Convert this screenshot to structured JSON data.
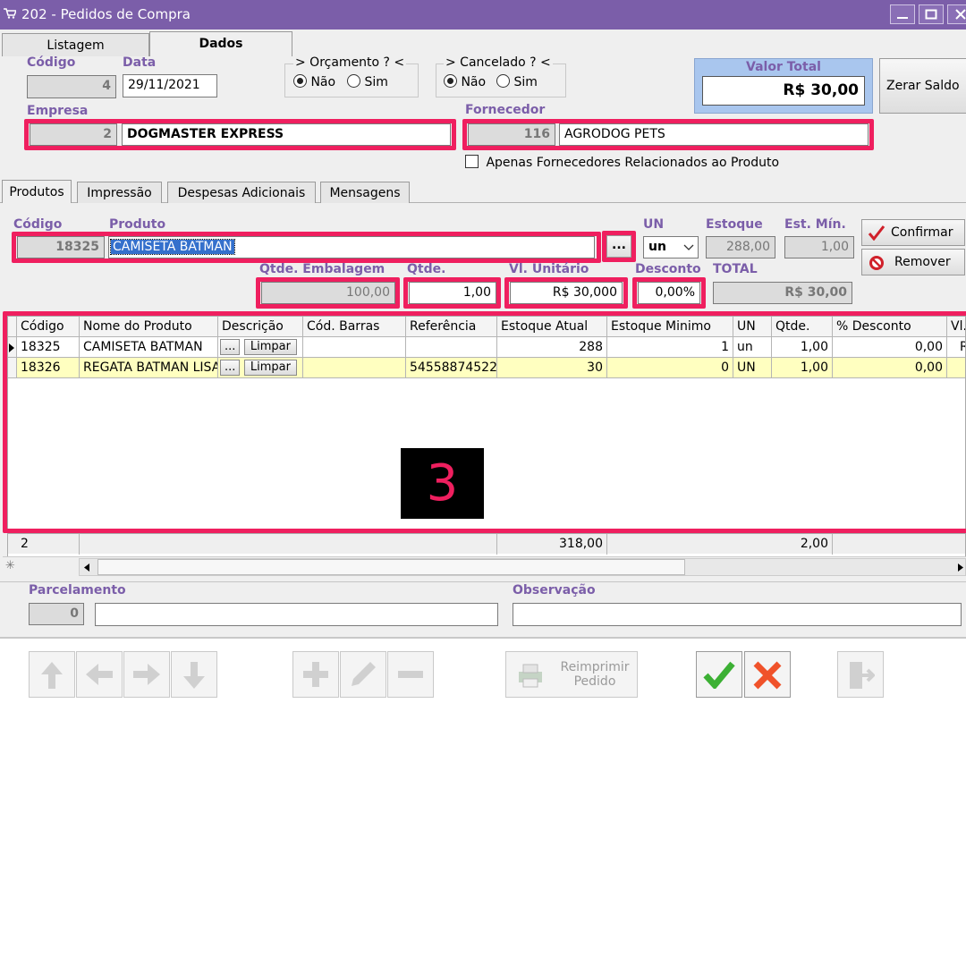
{
  "window": {
    "title": "202 - Pedidos de Compra"
  },
  "main_tabs": [
    {
      "label": "Listagem"
    },
    {
      "label": "Dados"
    }
  ],
  "header": {
    "codigo_label": "Código",
    "codigo_value": "4",
    "data_label": "Data",
    "data_value": "29/11/2021",
    "orcamento": {
      "legend": "> Orçamento ? <",
      "opt_nao": "Não",
      "opt_sim": "Sim",
      "selected": "Não"
    },
    "cancelado": {
      "legend": "> Cancelado ? <",
      "opt_nao": "Não",
      "opt_sim": "Sim",
      "selected": "Não"
    },
    "valor_total_label": "Valor Total",
    "valor_total_value": "R$ 30,00",
    "zerar_saldo": "Zerar Saldo",
    "empresa_label": "Empresa",
    "empresa_code": "2",
    "empresa_name": "DOGMASTER EXPRESS",
    "fornecedor_label": "Fornecedor",
    "fornecedor_code": "116",
    "fornecedor_name": "AGRODOG PETS",
    "apenas_checkbox": "Apenas Fornecedores Relacionados ao Produto"
  },
  "sub_tabs": [
    {
      "label": "Produtos"
    },
    {
      "label": "Impressão"
    },
    {
      "label": "Despesas Adicionais"
    },
    {
      "label": "Mensagens"
    }
  ],
  "product_form": {
    "codigo_label": "Código",
    "codigo_value": "18325",
    "produto_label": "Produto",
    "produto_value": "CAMISETA BATMAN",
    "lookup_button": "...",
    "un_label": "UN",
    "un_value": "un",
    "estoque_label": "Estoque",
    "estoque_value": "288,00",
    "est_min_label": "Est. Mín.",
    "est_min_value": "1,00",
    "confirmar": "Confirmar",
    "remover": "Remover",
    "qtde_emb_label": "Qtde. Embalagem",
    "qtde_emb_value": "100,00",
    "qtde_label": "Qtde.",
    "qtde_value": "1,00",
    "vl_unit_label": "Vl. Unitário",
    "vl_unit_value": "R$ 30,000",
    "desconto_label": "Desconto",
    "desconto_value": "0,00%",
    "total_label": "TOTAL",
    "total_value": "R$ 30,00"
  },
  "grid": {
    "columns": [
      "Código",
      "Nome do Produto",
      "Descrição",
      "Cód. Barras",
      "Referência",
      "Estoque Atual",
      "Estoque Minimo",
      "UN",
      "Qtde.",
      "% Desconto",
      "Vl."
    ],
    "rows": [
      {
        "codigo": "18325",
        "nome": "CAMISETA BATMAN",
        "desc_btn": "...",
        "limpar": "Limpar",
        "barras": "",
        "referencia": "",
        "estoque": "288",
        "minimo": "1",
        "un": "un",
        "qtde": "1,00",
        "desconto": "0,00",
        "vl": "R"
      },
      {
        "codigo": "18326",
        "nome": "REGATA BATMAN LISA",
        "desc_btn": "...",
        "limpar": "Limpar",
        "barras": "",
        "referencia": "54558874522",
        "estoque": "30",
        "minimo": "0",
        "un": "UN",
        "qtde": "1,00",
        "desconto": "0,00",
        "vl": ""
      }
    ],
    "footer": {
      "count": "2",
      "estoque_total": "318,00",
      "qtde_total": "2,00"
    },
    "annotation_number": "3"
  },
  "bottom": {
    "parcelamento_label": "Parcelamento",
    "parcelamento_value": "0",
    "observacao_label": "Observação",
    "observacao_value": ""
  },
  "toolbar": {
    "reimprimir": "Reimprimir Pedido"
  },
  "colors": {
    "accent": "#7b5ea9",
    "highlight": "#ef1f5f",
    "selected_row": "#ffffc0",
    "valor_total_bg": "#a9c6ee"
  }
}
